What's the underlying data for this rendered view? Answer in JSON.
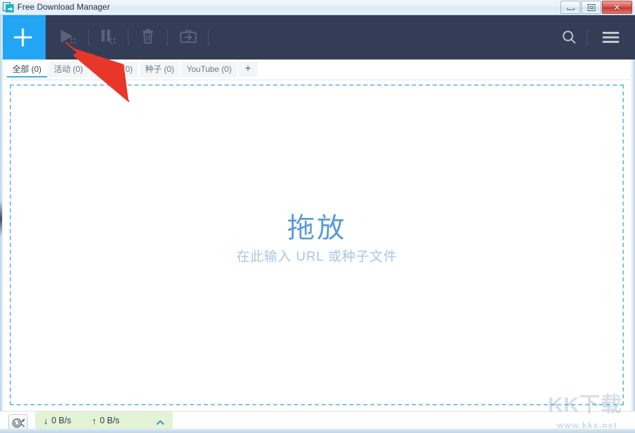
{
  "window": {
    "title": "Free Download Manager",
    "icon": "download-document-icon",
    "controls": {
      "minimize": "minimize-button",
      "maximize": "maximize-button",
      "close_label": "✕"
    }
  },
  "toolbar": {
    "background": "#333e56",
    "add_button": {
      "name": "add-download-button",
      "label": "+",
      "color": "#22a5f5",
      "enabled": true
    },
    "items": [
      {
        "name": "start-download-button",
        "icon": "play-icon",
        "enabled": false
      },
      {
        "name": "pause-download-button",
        "icon": "pause-icon",
        "enabled": false
      },
      {
        "name": "delete-download-button",
        "icon": "trash-icon",
        "enabled": false
      },
      {
        "name": "move-download-button",
        "icon": "briefcase-arrow-icon",
        "enabled": false
      }
    ],
    "right_items": [
      {
        "name": "search-button",
        "icon": "search-icon"
      },
      {
        "name": "menu-button",
        "icon": "hamburger-menu-icon"
      }
    ]
  },
  "tabs": {
    "active_index": 0,
    "accent": "#3fa9f5",
    "items": [
      {
        "label": "全部 (0)"
      },
      {
        "label": "活动 (0)"
      },
      {
        "label": "已完成 (0)"
      },
      {
        "label": "种子 (0)"
      },
      {
        "label": "YouTube (0)"
      }
    ],
    "add_tab_label": "+"
  },
  "dropzone": {
    "title": "拖放",
    "subtitle": "在此输入 URL 或种子文件",
    "border_color": "#7fc3ee",
    "title_color": "#5b9bd8",
    "subtitle_color": "#a8c7e6"
  },
  "statusbar": {
    "speed_limit_icon": "snail-icon",
    "download_arrow": "↓",
    "download_speed": "0 B/s",
    "upload_arrow": "↑",
    "upload_speed": "0 B/s",
    "expander_icon": "chevron-up-icon",
    "panel_color": "#e4f2d6",
    "accent_color": "#76c043"
  },
  "watermark": {
    "text": "KK下载",
    "url": "www.kkx.net"
  },
  "annotation": {
    "arrow_color": "#e8362a",
    "points_to": "start-download-button"
  }
}
